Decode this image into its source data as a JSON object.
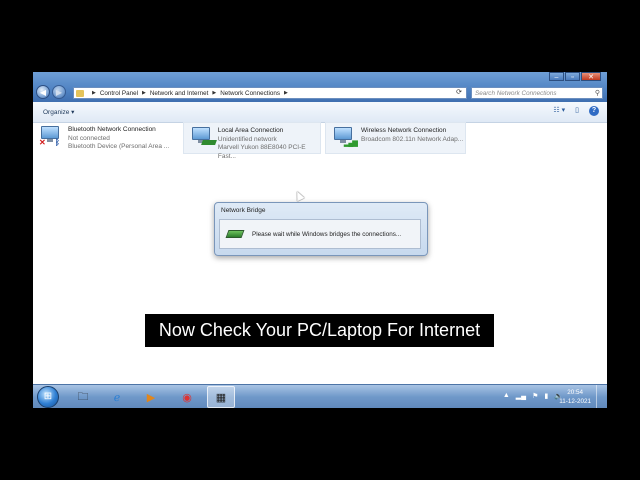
{
  "address_bar": {
    "path": [
      "Control Panel",
      "Network and Internet",
      "Network Connections"
    ]
  },
  "search": {
    "placeholder": "Search Network Connections"
  },
  "toolbar": {
    "organize_label": "Organize ▾"
  },
  "connections": [
    {
      "name": "Bluetooth Network Connection",
      "status": "Not connected",
      "device": "Bluetooth Device (Personal Area ...",
      "icon": "bluetooth-icon"
    },
    {
      "name": "Local Area Connection",
      "status": "Unidentified network",
      "device": "Marvell Yukon 88E8040 PCI-E Fast...",
      "icon": "ethernet-icon"
    },
    {
      "name": "Wireless Network Connection",
      "status": "",
      "device": "Broadcom 802.11n Network Adap...",
      "icon": "wifi-signal-icon"
    }
  ],
  "dialog": {
    "title": "Network Bridge",
    "message": "Please wait while Windows bridges the connections..."
  },
  "caption": "Now Check Your PC/Laptop For Internet",
  "taskbar": {
    "time": "20:54",
    "date": "11-12-2021"
  },
  "colors": {
    "window_frame": "#4f82c2",
    "taskbar": "#6f98c9"
  }
}
